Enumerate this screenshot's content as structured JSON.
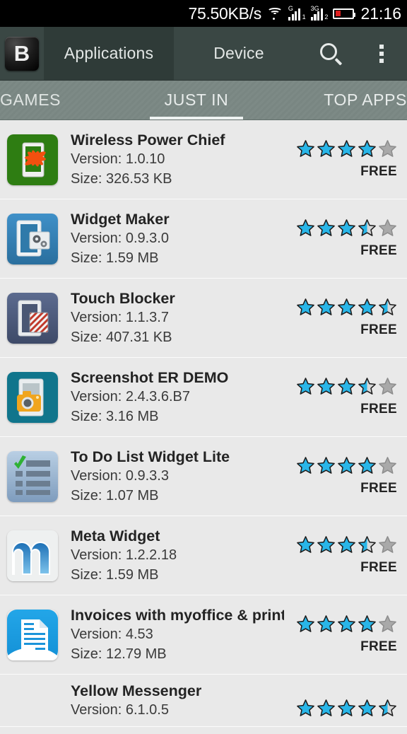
{
  "statusbar": {
    "net_speed": "75.50KB/s",
    "clock": "21:16",
    "wifi_icon": "wifi-icon",
    "signal1_label": "G",
    "signal1_sub": "1",
    "signal2_label": "3G",
    "signal2_sub": "2",
    "battery_icon": "battery-low-icon",
    "battery_level_pct": 30,
    "battery_color": "#e02020"
  },
  "actionbar": {
    "logo_letter": "B",
    "tabs": [
      {
        "label": "Applications",
        "active": true
      },
      {
        "label": "Device",
        "active": false
      }
    ],
    "search_icon": "search-icon",
    "overflow_icon": "overflow-menu-icon"
  },
  "tabstrip": {
    "tabs": [
      {
        "label": "GAMES",
        "active": false
      },
      {
        "label": "JUST IN",
        "active": true
      },
      {
        "label": "TOP APPS",
        "active": false
      }
    ]
  },
  "list": {
    "version_prefix": "Version: ",
    "size_prefix": "Size: ",
    "items": [
      {
        "name": "Wireless Power Chief",
        "version": "Version: 1.0.10",
        "size": "Size: 326.53 KB",
        "rating": 4,
        "price": "FREE",
        "icon": "wireless-power-chief-icon"
      },
      {
        "name": "Widget Maker",
        "version": "Version: 0.9.3.0",
        "size": "Size: 1.59 MB",
        "rating": 3.5,
        "price": "FREE",
        "icon": "widget-maker-icon"
      },
      {
        "name": "Touch Blocker",
        "version": "Version: 1.1.3.7",
        "size": "Size: 407.31 KB",
        "rating": 4.5,
        "price": "FREE",
        "icon": "touch-blocker-icon"
      },
      {
        "name": "Screenshot ER DEMO",
        "version": "Version: 2.4.3.6.B7",
        "size": "Size: 3.16 MB",
        "rating": 3.5,
        "price": "FREE",
        "icon": "screenshot-er-demo-icon"
      },
      {
        "name": "To Do List Widget Lite",
        "version": "Version: 0.9.3.3",
        "size": "Size: 1.07 MB",
        "rating": 4,
        "price": "FREE",
        "icon": "to-do-list-widget-lite-icon"
      },
      {
        "name": "Meta Widget",
        "version": "Version: 1.2.2.18",
        "size": "Size: 1.59 MB",
        "rating": 3.5,
        "price": "FREE",
        "icon": "meta-widget-icon"
      },
      {
        "name": "Invoices with myoffice & print",
        "version": "Version: 4.53",
        "size": "Size: 12.79 MB",
        "rating": 4,
        "price": "FREE",
        "icon": "invoices-myoffice-print-icon"
      },
      {
        "name": "Yellow Messenger",
        "version": "Version: 6.1.0.5",
        "size": "",
        "rating": 4.5,
        "price": "",
        "icon": "yellow-messenger-icon"
      }
    ]
  },
  "colors": {
    "star_filled": "#29b6e8",
    "star_empty": "#a9a9a9",
    "actionbar_bg": "#3a4744",
    "actionbar_active": "#2f3b38",
    "tabstrip_bg": "#7d8a86",
    "list_bg": "#e9e9e9"
  }
}
